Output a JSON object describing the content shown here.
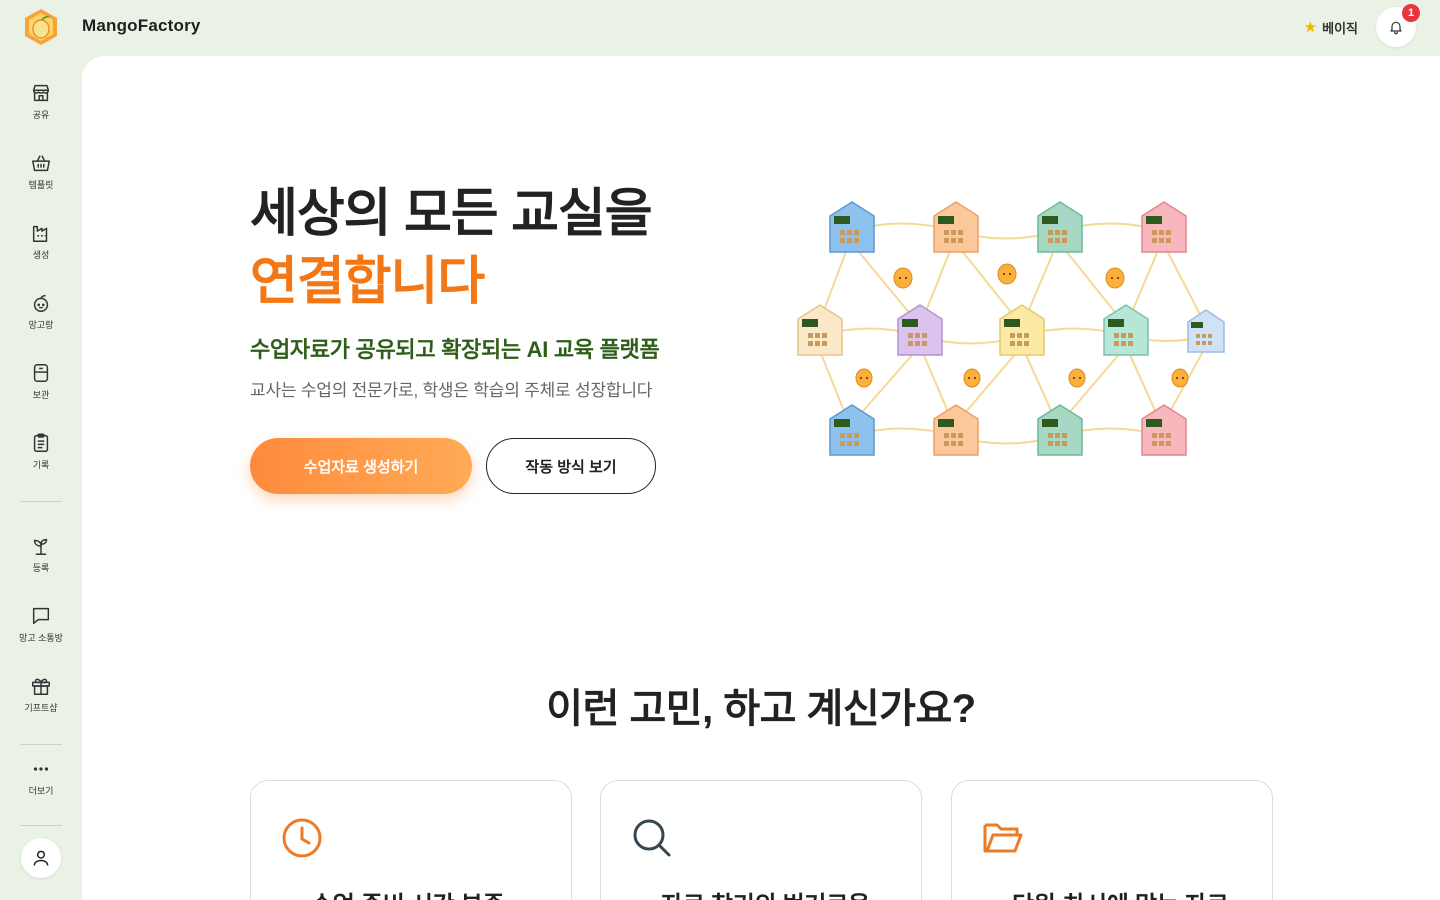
{
  "app": {
    "name": "MangoFactory"
  },
  "header": {
    "plan_label": "베이직",
    "notification_count": "1"
  },
  "sidebar": {
    "items": [
      {
        "label": "공유",
        "icon": "store-icon"
      },
      {
        "label": "템플릿",
        "icon": "basket-icon"
      },
      {
        "label": "생성",
        "icon": "factory-icon"
      },
      {
        "label": "망고랑",
        "icon": "mango-icon"
      },
      {
        "label": "보관",
        "icon": "storage-icon"
      },
      {
        "label": "기록",
        "icon": "clipboard-icon"
      },
      {
        "label": "등록",
        "icon": "sprout-icon"
      },
      {
        "label": "망고 소통방",
        "icon": "chat-icon"
      },
      {
        "label": "기프트샵",
        "icon": "gift-icon"
      },
      {
        "label": "더보기",
        "icon": "more-icon"
      }
    ]
  },
  "hero": {
    "title_line1": "세상의 모든 교실을",
    "title_line2": "연결합니다",
    "subtitle": "수업자료가 공유되고 확장되는 AI 교육 플랫폼",
    "description": "교사는 수업의 전문가로, 학생은 학습의 주체로 성장합니다",
    "primary_button": "수업자료 생성하기",
    "secondary_button": "작동 방식 보기"
  },
  "problems": {
    "title": "이런 고민, 하고 계신가요?",
    "cards": [
      {
        "title": "수업 준비 시간 부족",
        "icon": "clock-icon"
      },
      {
        "title": "자료 찾기의 번거로움",
        "icon": "search-icon"
      },
      {
        "title": "단원·차시에 맞는 자료",
        "icon": "folder-open-icon"
      }
    ]
  },
  "colors": {
    "accent": "#f47716",
    "brand_green": "#2f5e1a",
    "sidebar_bg": "#eaf2e6"
  }
}
